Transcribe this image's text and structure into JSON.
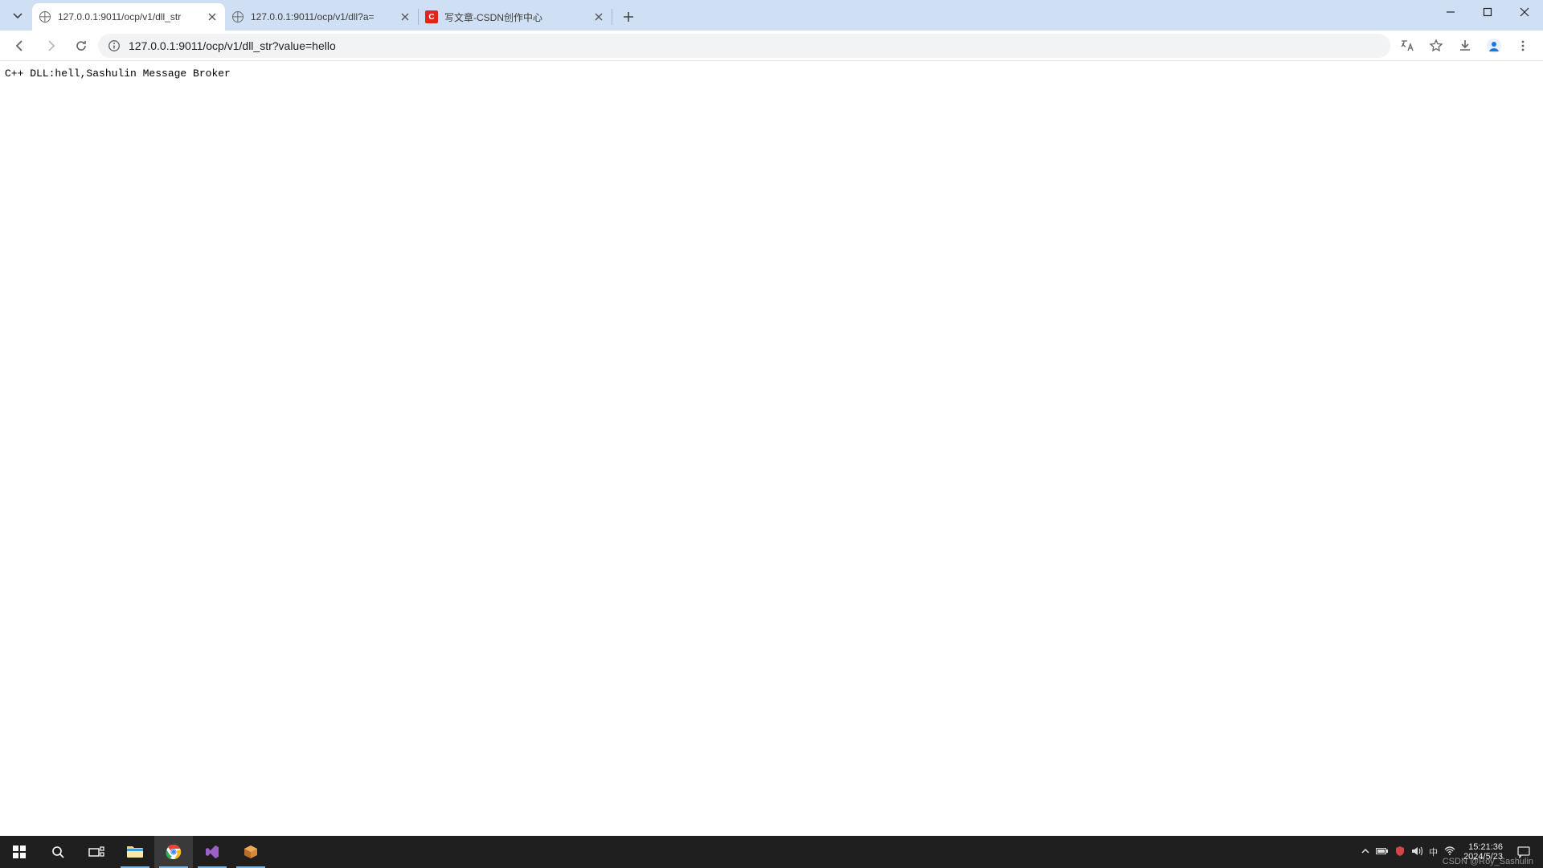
{
  "window": {
    "minimize": "min",
    "maximize": "max",
    "close": "close"
  },
  "tabs": [
    {
      "title": "127.0.0.1:9011/ocp/v1/dll_str",
      "favicon": "globe",
      "active": true
    },
    {
      "title": "127.0.0.1:9011/ocp/v1/dll?a=",
      "favicon": "globe",
      "active": false
    },
    {
      "title": "写文章-CSDN创作中心",
      "favicon": "csdn",
      "active": false
    }
  ],
  "toolbar": {
    "url": "127.0.0.1:9011/ocp/v1/dll_str?value=hello"
  },
  "page": {
    "body_text": "C++ DLL:hell,Sashulin Message Broker"
  },
  "taskbar": {
    "time": "15:21:36",
    "date": "2024/5/23",
    "watermark": "CSDN @Roy_Sashulin"
  }
}
